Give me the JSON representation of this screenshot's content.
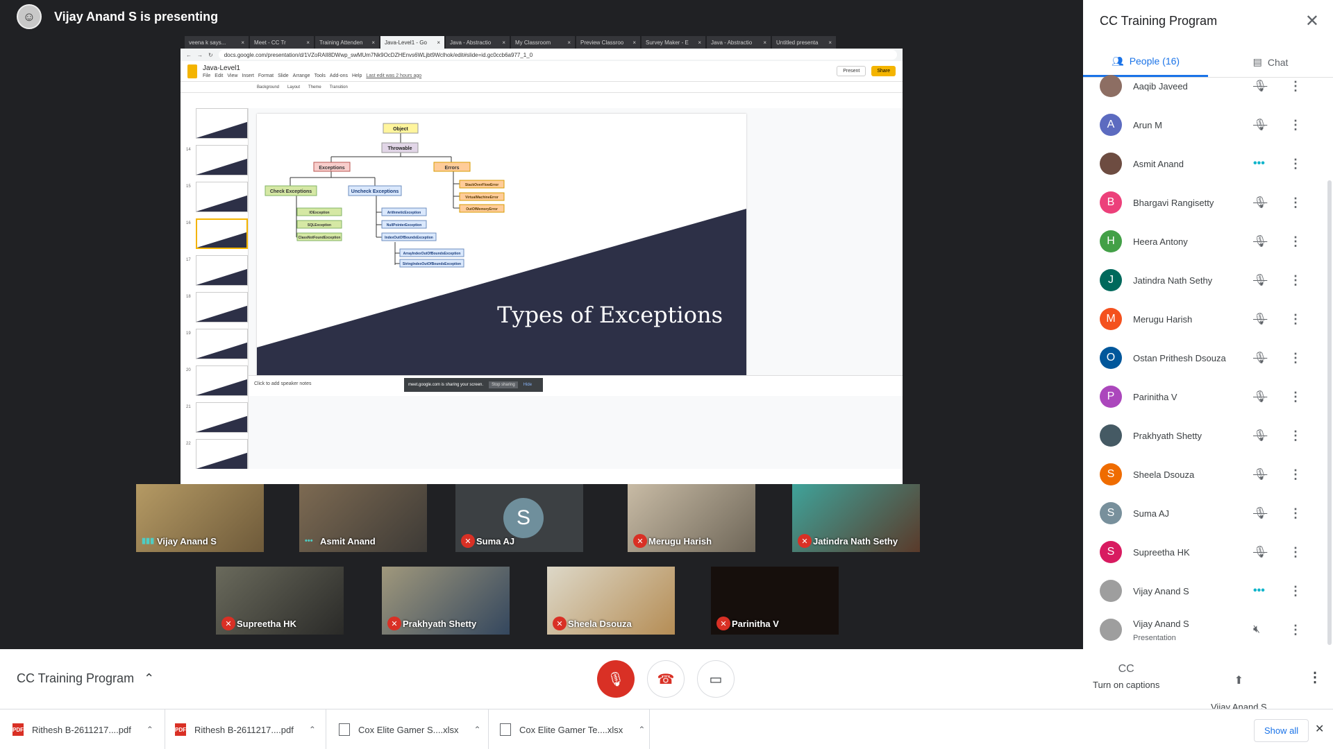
{
  "presenter": {
    "title": "Vijay Anand S is presenting"
  },
  "browser": {
    "tabs": [
      "veena k says...",
      "Meet - CC Tr",
      "Training Attenden",
      "Java-Level1 - Go",
      "Java - Abstractio",
      "My Classroom",
      "Preview Classroo",
      "Survey Maker - E",
      "Java - Abstractio",
      "Untitled presenta"
    ],
    "active_tab": 3,
    "url": "docs.google.com/presentation/d/1VZoRAIl8DWwp_swMUm7Nk9OcDZHEnvs6WLjbt9Wclhok/edit#slide=id.gc0ccb6a977_1_0"
  },
  "docs": {
    "title": "Java-Level1",
    "menu": [
      "File",
      "Edit",
      "View",
      "Insert",
      "Format",
      "Slide",
      "Arrange",
      "Tools",
      "Add-ons",
      "Help"
    ],
    "last_edit": "Last edit was 2 hours ago",
    "present": "Present",
    "share": "Share",
    "toolbar": [
      "Background",
      "Layout",
      "Theme",
      "Transition"
    ],
    "speaker_notes": "Click to add speaker notes",
    "sharing_banner": "meet.google.com is sharing your screen.",
    "stop_sharing": "Stop sharing",
    "hide": "Hide",
    "slide_numbers": [
      "",
      "14",
      "15",
      "16",
      "17",
      "18",
      "19",
      "20",
      "21",
      "22",
      "23"
    ]
  },
  "slide": {
    "title": "Types of Exceptions",
    "nodes": {
      "object": "Object",
      "throwable": "Throwable",
      "exceptions": "Exceptions",
      "errors": "Errors",
      "check": "Check Exceptions",
      "uncheck": "Uncheck Exceptions",
      "io": "IOException",
      "sql": "SQLException",
      "cnf": "ClassNotFoundException",
      "arith": "ArithmeticException",
      "npe": "NullPointerException",
      "ioobe": "IndexOutOfBoundsException",
      "aioobe": "ArrayIndexOutOfBoundsException",
      "sioobe": "StringIndexOutOfBoundsException",
      "soe": "StackOverFlowError",
      "vme": "VirtualMachineError",
      "oom": "OutOfMemoryError"
    }
  },
  "tiles": [
    {
      "name": "Vijay Anand S",
      "state": "talking"
    },
    {
      "name": "Asmit Anand",
      "state": "talking"
    },
    {
      "name": "Suma AJ",
      "state": "muted",
      "initial": "S"
    },
    {
      "name": "Merugu Harish",
      "state": "muted"
    },
    {
      "name": "Jatindra Nath Sethy",
      "state": "muted"
    },
    {
      "name": "Supreetha HK",
      "state": "muted"
    },
    {
      "name": "Prakhyath Shetty",
      "state": "muted"
    },
    {
      "name": "Sheela Dsouza",
      "state": "muted"
    },
    {
      "name": "Parinitha V",
      "state": "muted"
    }
  ],
  "panel": {
    "title": "CC Training Program",
    "people_tab": "People (16)",
    "chat_tab": "Chat",
    "people": [
      {
        "name": "Aaqib Javeed",
        "initial": "",
        "color": "#8d6e63",
        "mic": "muted"
      },
      {
        "name": "Arun M",
        "initial": "A",
        "color": "#5c6bc0",
        "mic": "muted"
      },
      {
        "name": "Asmit Anand",
        "initial": "",
        "color": "#6d4c41",
        "mic": "talking"
      },
      {
        "name": "Bhargavi Rangisetty",
        "initial": "B",
        "color": "#ec407a",
        "mic": "muted"
      },
      {
        "name": "Heera Antony",
        "initial": "H",
        "color": "#43a047",
        "mic": "muted"
      },
      {
        "name": "Jatindra Nath Sethy",
        "initial": "J",
        "color": "#00695c",
        "mic": "muted"
      },
      {
        "name": "Merugu Harish",
        "initial": "M",
        "color": "#f4511e",
        "mic": "muted"
      },
      {
        "name": "Ostan Prithesh Dsouza",
        "initial": "O",
        "color": "#01579b",
        "mic": "muted"
      },
      {
        "name": "Parinitha V",
        "initial": "P",
        "color": "#ab47bc",
        "mic": "muted"
      },
      {
        "name": "Prakhyath Shetty",
        "initial": "",
        "color": "#455a64",
        "mic": "muted"
      },
      {
        "name": "Sheela Dsouza",
        "initial": "S",
        "color": "#ef6c00",
        "mic": "muted"
      },
      {
        "name": "Suma AJ",
        "initial": "S",
        "color": "#78909c",
        "mic": "muted"
      },
      {
        "name": "Supreetha HK",
        "initial": "S",
        "color": "#d81b60",
        "mic": "muted"
      },
      {
        "name": "Vijay Anand S",
        "initial": "",
        "color": "#9e9e9e",
        "mic": "talking"
      },
      {
        "name": "Vijay Anand S",
        "sub": "Presentation",
        "initial": "",
        "color": "#9e9e9e",
        "mic": "presentation"
      }
    ]
  },
  "bottom": {
    "meeting_name": "CC Training Program",
    "captions": "Turn on captions",
    "presenting": "Vijay Anand S\nis presenting"
  },
  "downloads": {
    "items": [
      {
        "name": "Rithesh B-2611217....pdf",
        "type": "PDF"
      },
      {
        "name": "Rithesh B-2611217....pdf",
        "type": "PDF"
      },
      {
        "name": "Cox Elite Gamer S....xlsx",
        "type": "doc"
      },
      {
        "name": "Cox Elite Gamer Te....xlsx",
        "type": "doc"
      }
    ],
    "show_all": "Show all"
  }
}
